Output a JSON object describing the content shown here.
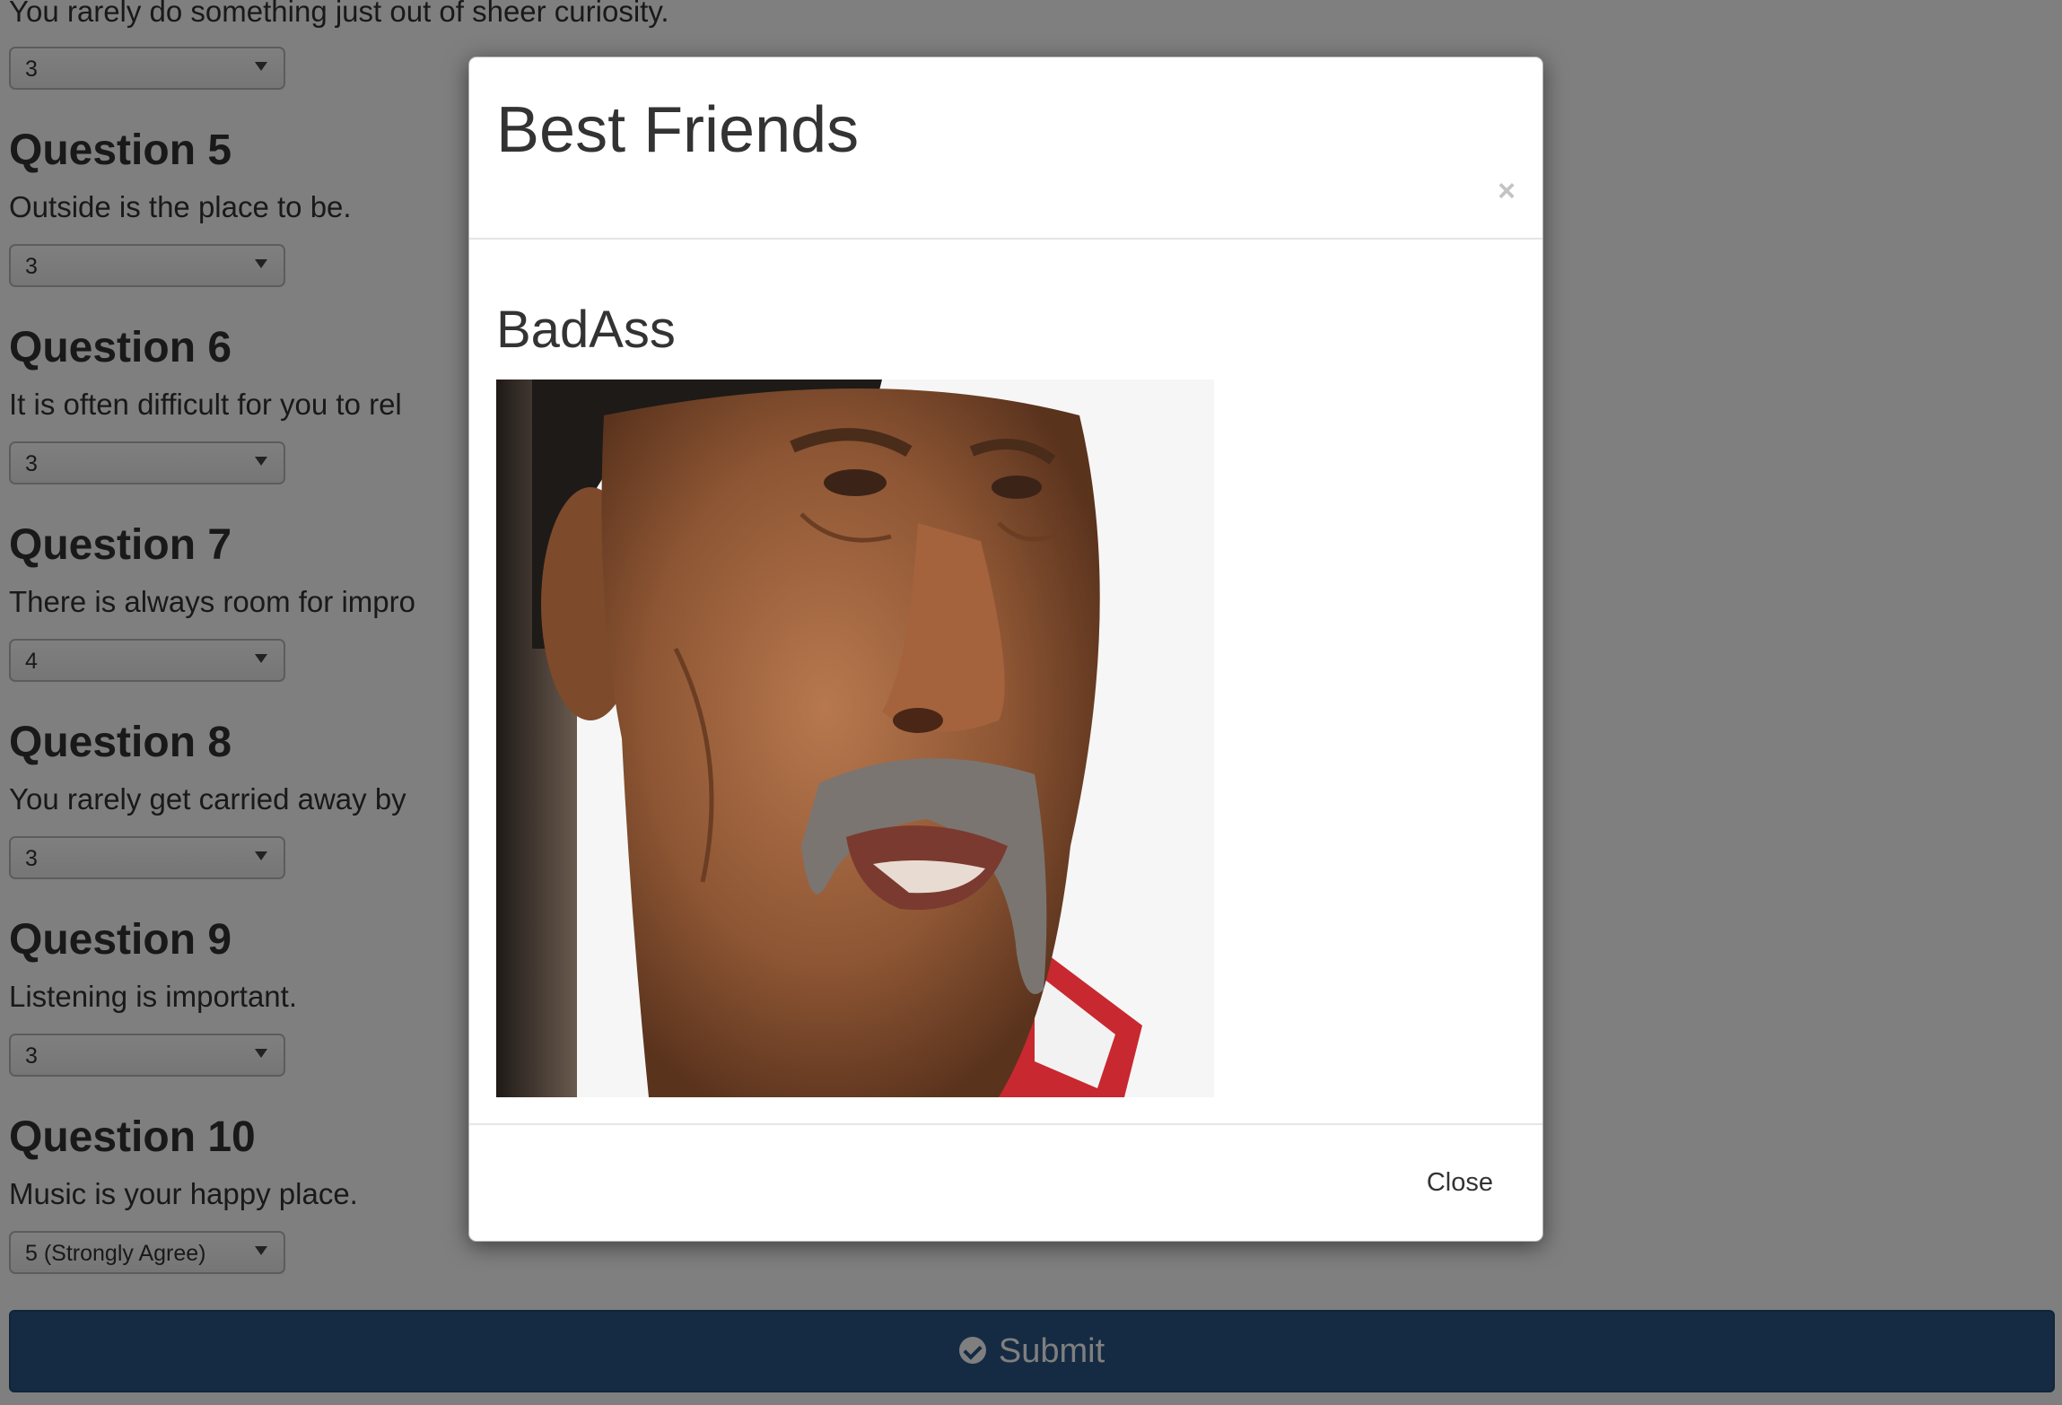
{
  "survey": {
    "top_partial": {
      "text": "You rarely do something just out of sheer curiosity.",
      "answer": "3"
    },
    "questions": [
      {
        "heading": "Question 5",
        "text": "Outside is the place to be.",
        "answer": "3"
      },
      {
        "heading": "Question 6",
        "text": "It is often difficult for you to rel",
        "answer": "3"
      },
      {
        "heading": "Question 7",
        "text": "There is always room for impro",
        "answer": "4"
      },
      {
        "heading": "Question 8",
        "text": "You rarely get carried away by",
        "answer": "3"
      },
      {
        "heading": "Question 9",
        "text": "Listening is important.",
        "answer": "3"
      },
      {
        "heading": "Question 10",
        "text": "Music is your happy place.",
        "answer": "5 (Strongly Agree)"
      }
    ],
    "submit_label": "Submit",
    "submit_icon": "check-circle-icon"
  },
  "modal": {
    "title": "Best Friends",
    "close_symbol": "×",
    "friend_name": "BadAss",
    "photo_icon": "portrait-photo",
    "close_label": "Close"
  },
  "colors": {
    "submit_bg": "#2a5686",
    "backdrop": "rgba(0,0,0,0.5)"
  }
}
